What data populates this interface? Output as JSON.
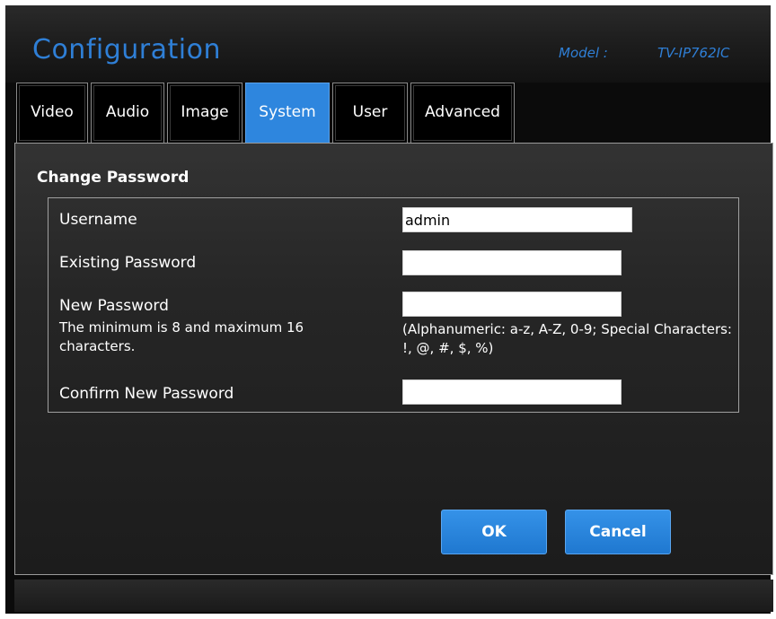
{
  "header": {
    "title": "Configuration",
    "model_label": "Model :",
    "model_value": "TV-IP762IC"
  },
  "tabs": [
    {
      "label": "Video",
      "active": false
    },
    {
      "label": "Audio",
      "active": false
    },
    {
      "label": "Image",
      "active": false
    },
    {
      "label": "System",
      "active": true
    },
    {
      "label": "User",
      "active": false
    },
    {
      "label": "Advanced",
      "active": false
    }
  ],
  "form": {
    "section_title": "Change Password",
    "username_label": "Username",
    "username_value": "admin",
    "existing_password_label": "Existing Password",
    "existing_password_value": "",
    "new_password_label": "New Password",
    "new_password_note": "The minimum is 8 and maximum 16 characters.",
    "new_password_value": "",
    "new_password_hint": "(Alphanumeric: a-z, A-Z, 0-9; Special Characters: !, @, #, $, %)",
    "confirm_password_label": "Confirm New Password",
    "confirm_password_value": ""
  },
  "buttons": {
    "ok_label": "OK",
    "cancel_label": "Cancel"
  },
  "colors": {
    "accent": "#2f7fd6",
    "active_tab": "#2e86de",
    "background": "#0b0b0b"
  }
}
